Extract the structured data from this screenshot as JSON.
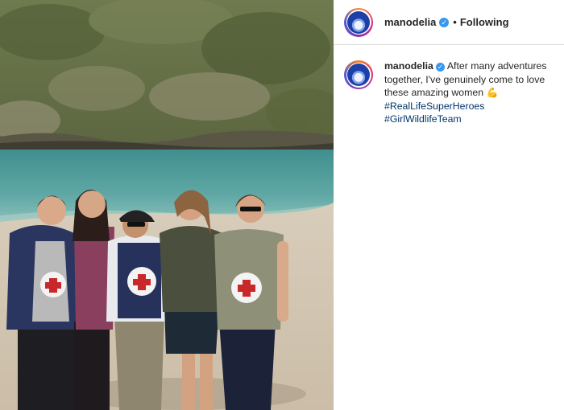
{
  "post": {
    "author": "manodelia",
    "follow_status": "Following",
    "separator": "•",
    "verified_glyph": "✓"
  },
  "caption": {
    "author": "manodelia",
    "text": "After many adventures together, I've genuinely come to love these amazing women",
    "emoji": "💪",
    "hashtags": [
      "#RealLifeSuperHeroes",
      "#GirlWildlifeTeam"
    ]
  },
  "colors": {
    "verified": "#3897f0",
    "hashtag": "#00376b",
    "divider": "#dbdbdb"
  },
  "icons": {
    "verified": "verified-badge-icon",
    "emoji": "flexed-biceps-emoji"
  }
}
